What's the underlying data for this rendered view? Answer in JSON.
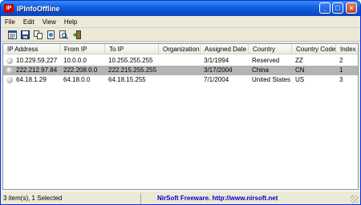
{
  "window": {
    "title": "IPInfoOffline",
    "app_icon_text": "IP"
  },
  "titlebar_buttons": {
    "minimize": "_",
    "maximize": "□",
    "close": "×"
  },
  "menu": [
    "File",
    "Edit",
    "View",
    "Help"
  ],
  "toolbar": {
    "icons": [
      "properties-icon",
      "save-icon",
      "copy-icon",
      "html-report-icon",
      "find-icon",
      "exit-icon"
    ]
  },
  "columns": [
    "IP Address",
    "From IP",
    "To IP",
    "Organization",
    "Assigned Date",
    "Country",
    "Country Code",
    "Index"
  ],
  "rows": [
    {
      "ip": "10.229.59.227",
      "from": "10.0.0.0",
      "to": "10.255.255.255",
      "org": "",
      "date": "3/1/1994",
      "country": "Reserved",
      "code": "ZZ",
      "index": "2",
      "selected": false
    },
    {
      "ip": "222.212.97.84",
      "from": "222.208.0.0",
      "to": "222.215.255.255",
      "org": "",
      "date": "3/17/2004",
      "country": "China",
      "code": "CN",
      "index": "1",
      "selected": true
    },
    {
      "ip": "64.18.1.29",
      "from": "64.18.0.0",
      "to": "64.18.15.255",
      "org": "",
      "date": "7/1/2004",
      "country": "United States",
      "code": "US",
      "index": "3",
      "selected": false
    }
  ],
  "status": {
    "summary": "3 item(s), 1 Selected",
    "link": "NirSoft Freeware.  http://www.nirsoft.net"
  },
  "colors": {
    "titlebar": "#0a4ccc",
    "selection": "#b4b4b4",
    "link": "#0000cc"
  }
}
